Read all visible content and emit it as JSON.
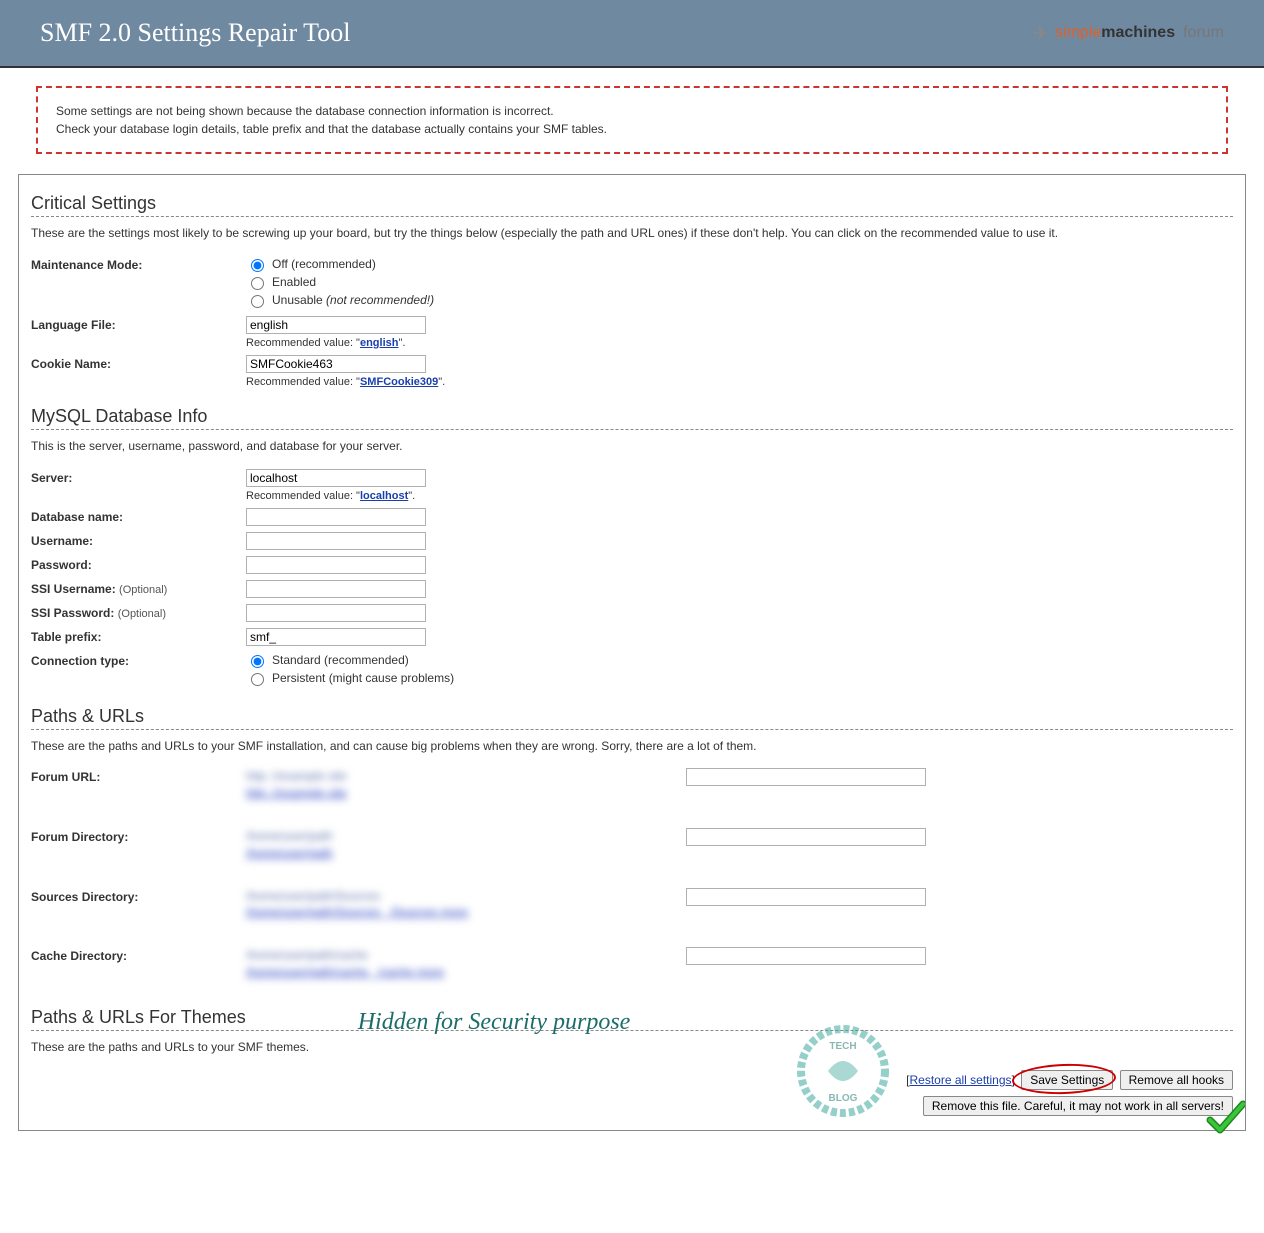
{
  "header": {
    "title": "SMF 2.0 Settings Repair Tool",
    "logo_simple": "simple",
    "logo_machines": "machines",
    "logo_forum": "forum"
  },
  "error_box": {
    "line1": "Some settings are not being shown because the database connection information is incorrect.",
    "line2": "Check your database login details, table prefix and that the database actually contains your SMF tables."
  },
  "critical": {
    "title": "Critical Settings",
    "desc": "These are the settings most likely to be screwing up your board, but try the things below (especially the path and URL ones) if these don't help. You can click on the recommended value to use it.",
    "maintenance_label": "Maintenance Mode:",
    "maintenance_off": "Off (recommended)",
    "maintenance_enabled": "Enabled",
    "maintenance_unusable": "Unusable",
    "maintenance_unusable_note": "(not recommended!)",
    "language_label": "Language File:",
    "language_value": "english",
    "language_reco_prefix": "Recommended value: \"",
    "language_reco_link": "english",
    "language_reco_suffix": "\".",
    "cookie_label": "Cookie Name:",
    "cookie_value": "SMFCookie463",
    "cookie_reco_prefix": "Recommended value: \"",
    "cookie_reco_link": "SMFCookie309",
    "cookie_reco_suffix": "\"."
  },
  "db": {
    "title": "MySQL Database Info",
    "desc": "This is the server, username, password, and database for your server.",
    "server_label": "Server:",
    "server_value": "localhost",
    "server_reco_prefix": "Recommended value: \"",
    "server_reco_link": "localhost",
    "server_reco_suffix": "\".",
    "dbname_label": "Database name:",
    "dbname_value": "",
    "username_label": "Username:",
    "username_value": "",
    "password_label": "Password:",
    "password_value": "",
    "ssi_user_label": "SSI Username:",
    "ssi_user_opt": "(Optional)",
    "ssi_user_value": "",
    "ssi_pass_label": "SSI Password:",
    "ssi_pass_opt": "(Optional)",
    "ssi_pass_value": "",
    "prefix_label": "Table prefix:",
    "prefix_value": "smf_",
    "conn_label": "Connection type:",
    "conn_standard": "Standard (recommended)",
    "conn_persist": "Persistent (might cause problems)"
  },
  "paths": {
    "title": "Paths & URLs",
    "desc": "These are the paths and URLs to your SMF installation, and can cause big problems when they are wrong. Sorry, there are a lot of them.",
    "forum_url_label": "Forum URL:",
    "forum_dir_label": "Forum Directory:",
    "sources_dir_label": "Sources Directory:",
    "cache_dir_label": "Cache Directory:",
    "hidden_overlay": "Hidden for Security purpose"
  },
  "themes": {
    "title": "Paths & URLs For Themes",
    "desc": "These are the paths and URLs to your SMF themes."
  },
  "footer": {
    "restore_prefix": "[",
    "restore_link": "Restore all settings",
    "restore_suffix": "]",
    "save_btn": "Save Settings",
    "remove_hooks_btn": "Remove all hooks",
    "remove_file_btn": "Remove this file. Careful, it may not work in all servers!"
  }
}
